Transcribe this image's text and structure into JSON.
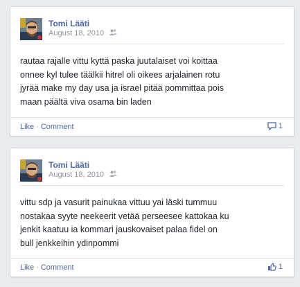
{
  "posts": [
    {
      "author": "Tomi Lääti",
      "date": "August 18, 2010",
      "privacy_icon": "friends-icon",
      "text": "rautaa rajalle vittu kyttä paska juutalaiset voi koittaa\nonnee kyl tulee täälkii hitrel oli oikees arjalainen rotu\njyrää make my day usa ja israel pitää pommittaa pois\nmaan päältä viva osama bin laden",
      "like_label": "Like",
      "separator": "·",
      "comment_label": "Comment",
      "counter_icon": "comment-icon",
      "counter_value": "1"
    },
    {
      "author": "Tomi Lääti",
      "date": "August 18, 2010",
      "privacy_icon": "friends-icon",
      "text": "vittu sdp ja vasurit painukaa vittuu yai läski tummuu\nnostakaa syyte neekeerit vetää perseesee kattokaa ku\njenkit kaatuu ia kommari jauskovaiset palaa fidel on\nbull jenkkeihin ydinpommi",
      "like_label": "Like",
      "separator": "·",
      "comment_label": "Comment",
      "counter_icon": "thumbs-up-icon",
      "counter_value": "1"
    }
  ],
  "colors": {
    "link": "#4b67a1",
    "name": "#3b5998",
    "meta": "#90949c",
    "background": "#e9ebee"
  }
}
